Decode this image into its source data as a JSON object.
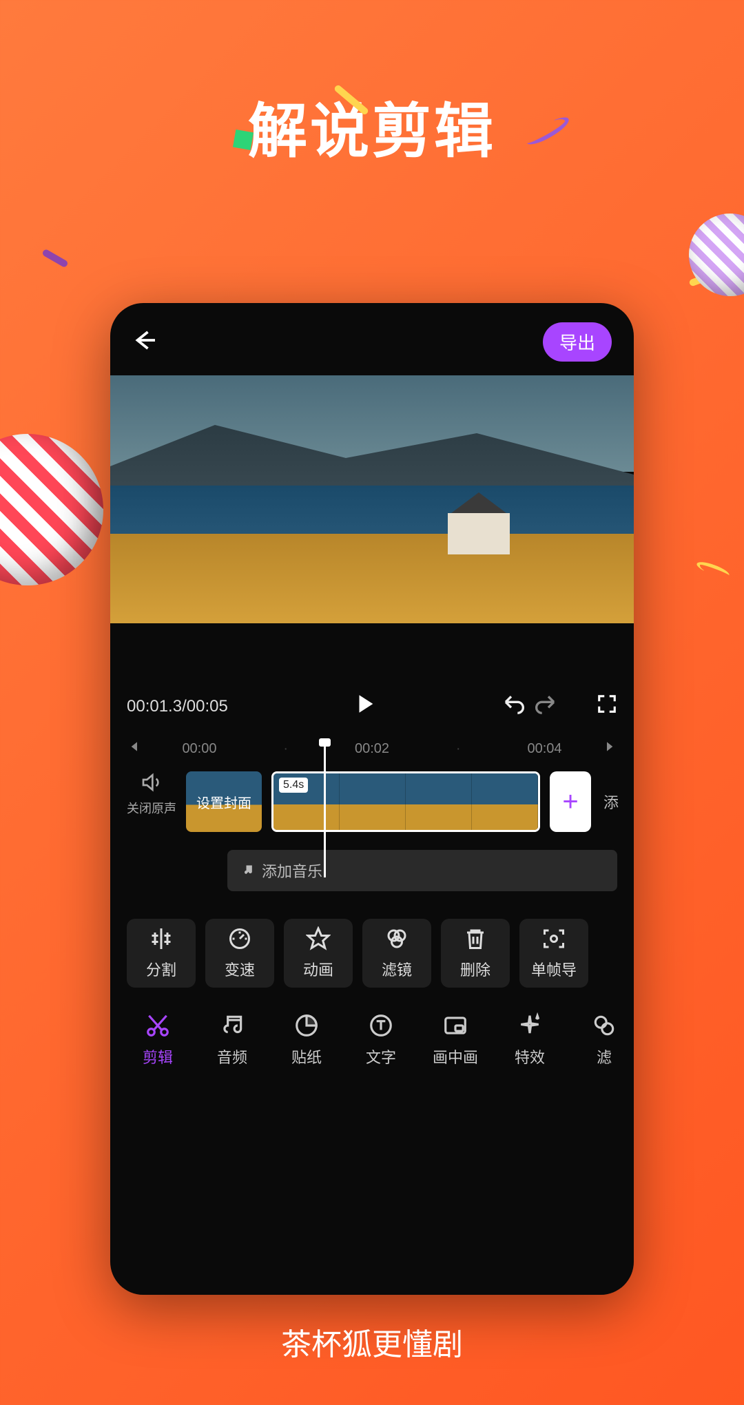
{
  "promo": {
    "title": "解说剪辑",
    "footer": "茶杯狐更懂剧"
  },
  "topbar": {
    "export_label": "导出"
  },
  "controls": {
    "current_time": "00:01.3",
    "total_time": "00:05"
  },
  "ruler": {
    "ticks": [
      "00:00",
      "00:02",
      "00:04"
    ]
  },
  "timeline": {
    "mute_label": "关闭原声",
    "cover_label": "设置封面",
    "clip_duration": "5.4s",
    "add_label": "添",
    "music_label": "添加音乐"
  },
  "edit_tools": [
    {
      "id": "split",
      "label": "分割"
    },
    {
      "id": "speed",
      "label": "变速"
    },
    {
      "id": "animate",
      "label": "动画"
    },
    {
      "id": "filter",
      "label": "滤镜"
    },
    {
      "id": "delete",
      "label": "删除"
    },
    {
      "id": "frame-export",
      "label": "单帧导"
    }
  ],
  "bottom_nav": [
    {
      "id": "edit",
      "label": "剪辑",
      "active": true
    },
    {
      "id": "audio",
      "label": "音频"
    },
    {
      "id": "sticker",
      "label": "贴纸"
    },
    {
      "id": "text",
      "label": "文字"
    },
    {
      "id": "pip",
      "label": "画中画"
    },
    {
      "id": "effects",
      "label": "特效"
    },
    {
      "id": "filter2",
      "label": "滤"
    }
  ]
}
